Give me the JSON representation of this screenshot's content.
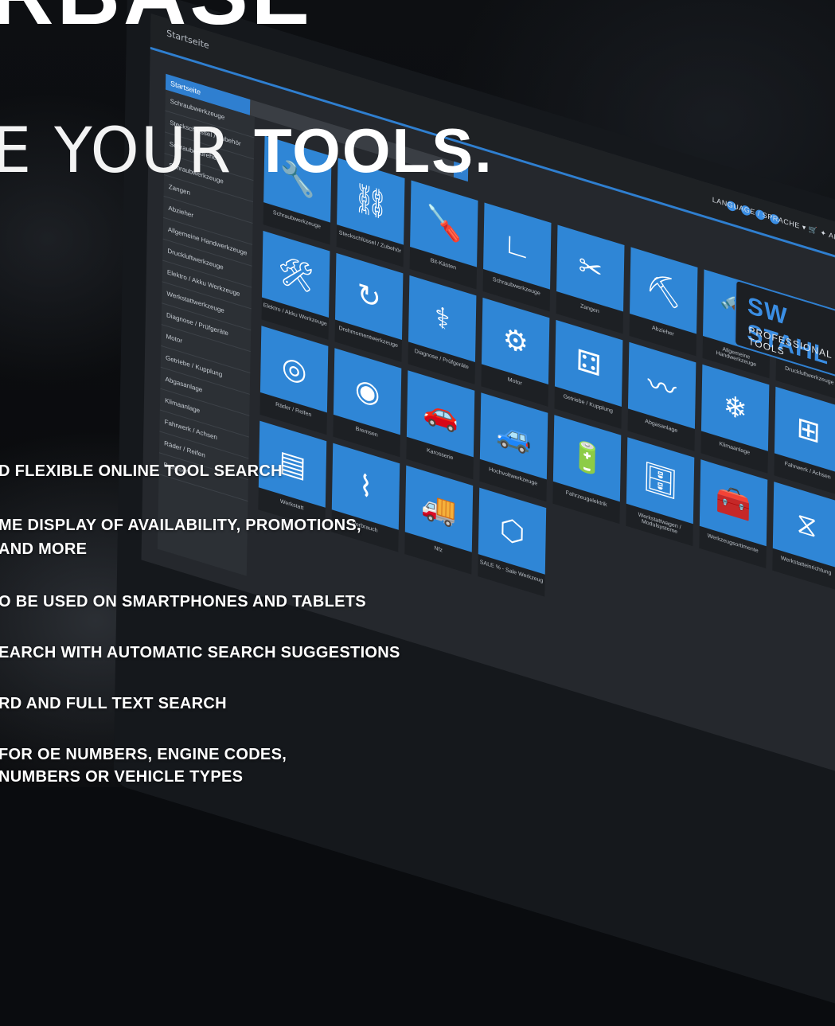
{
  "hero": {
    "top_fragment": "RBASE",
    "line_thin": "E YOUR ",
    "line_bold": "TOOLS."
  },
  "screen": {
    "menu_text": "Startseite",
    "search": {
      "category": "Startseite",
      "go_icon": "search-icon"
    },
    "language": "LANGUAGE / SPRACHE ▾   🛒   ✦ ANMELDEN",
    "brand": {
      "name": "SW STAHL",
      "tagline": "PROFESSIONAL TOOLS"
    },
    "sidebar": [
      "Schraubwerkzeuge",
      "Steckschlüssel / Zubehör",
      "Schraubendreher",
      "Schraubwerkzeuge",
      "Zangen",
      "Abzieher",
      "Allgemeine Handwerkzeuge",
      "Druckluftwerkzeuge",
      "Elektro / Akku Werkzeuge",
      "Werkstattwerkzeuge",
      "Diagnose / Prüfgeräte",
      "Motor",
      "Getriebe / Kupplung",
      "Abgasanlage",
      "Klimaanlage",
      "Fahrwerk / Achsen",
      "Räder / Reifen",
      "Bremsen"
    ],
    "tiles": [
      {
        "icon": "wrench-icon",
        "glyph": "🔧",
        "label": "Schraubwerkzeuge"
      },
      {
        "icon": "socket-icon",
        "glyph": "⛓",
        "label": "Steckschlüssel / Zubehör"
      },
      {
        "icon": "screwdriver-icon",
        "glyph": "🪛",
        "label": "Bit-Kästen"
      },
      {
        "icon": "hex-key-icon",
        "glyph": "∟",
        "label": "Schraubwerkzeuge"
      },
      {
        "icon": "pliers-icon",
        "glyph": "✂",
        "label": "Zangen"
      },
      {
        "icon": "puller-icon",
        "glyph": "⛏",
        "label": "Abzieher"
      },
      {
        "icon": "hammer-icon",
        "glyph": "🔨",
        "label": "Allgemeine Handwerkzeuge"
      },
      {
        "icon": "impact-wrench-icon",
        "glyph": "🔫",
        "label": "Druckluftwerkzeuge"
      },
      {
        "icon": "drill-icon",
        "glyph": "🛠",
        "label": "Elektro / Akku Werkzeuge"
      },
      {
        "icon": "torque-icon",
        "glyph": "↻",
        "label": "Drehmomentwerkzeuge"
      },
      {
        "icon": "stethoscope-icon",
        "glyph": "⚕",
        "label": "Diagnose / Prüfgeräte"
      },
      {
        "icon": "engine-icon",
        "glyph": "⚙",
        "label": "Motor"
      },
      {
        "icon": "gearbox-icon",
        "glyph": "⚃",
        "label": "Getriebe / Kupplung"
      },
      {
        "icon": "exhaust-icon",
        "glyph": "〰",
        "label": "Abgasanlage"
      },
      {
        "icon": "snowflake-icon",
        "glyph": "❄",
        "label": "Klimaanlage"
      },
      {
        "icon": "axle-icon",
        "glyph": "⊞",
        "label": "Fahrwerk / Achsen"
      },
      {
        "icon": "wheel-icon",
        "glyph": "◎",
        "label": "Räder / Reifen"
      },
      {
        "icon": "brake-disc-icon",
        "glyph": "◉",
        "label": "Bremsen"
      },
      {
        "icon": "car-body-icon",
        "glyph": "🚗",
        "label": "Karosserie"
      },
      {
        "icon": "ev-car-icon",
        "glyph": "🚙",
        "label": "Hochvoltwerkzeuge"
      },
      {
        "icon": "battery-icon",
        "glyph": "🔋",
        "label": "Fahrzeugelektrik"
      },
      {
        "icon": "cabinet-icon",
        "glyph": "🗄",
        "label": "Werkstattwagen / Modulsysteme"
      },
      {
        "icon": "toolbox-icon",
        "glyph": "🧰",
        "label": "Werkzeugsortimente"
      },
      {
        "icon": "jack-stand-icon",
        "glyph": "⧖",
        "label": "Werkstatteinrichtung"
      },
      {
        "icon": "workbench-icon",
        "glyph": "▤",
        "label": "Werkstatt"
      },
      {
        "icon": "tube-icon",
        "glyph": "⌇",
        "label": "Verbrauch"
      },
      {
        "icon": "truck-icon",
        "glyph": "🚚",
        "label": "Nfz"
      },
      {
        "icon": "gasket-icon",
        "glyph": "⬡",
        "label": "SALE % - Sale Werkzeug"
      }
    ]
  },
  "features": [
    "D FLEXIBLE ONLINE TOOL SEARCH",
    "ME DISPLAY OF AVAILABILITY, PROMOTIONS,",
    "AND MORE",
    "O BE USED ON SMARTPHONES AND TABLETS",
    "EARCH WITH AUTOMATIC SEARCH SUGGESTIONS",
    "RD AND FULL TEXT SEARCH",
    "FOR OE NUMBERS, ENGINE CODES,",
    "NUMBERS OR VEHICLE TYPES"
  ]
}
